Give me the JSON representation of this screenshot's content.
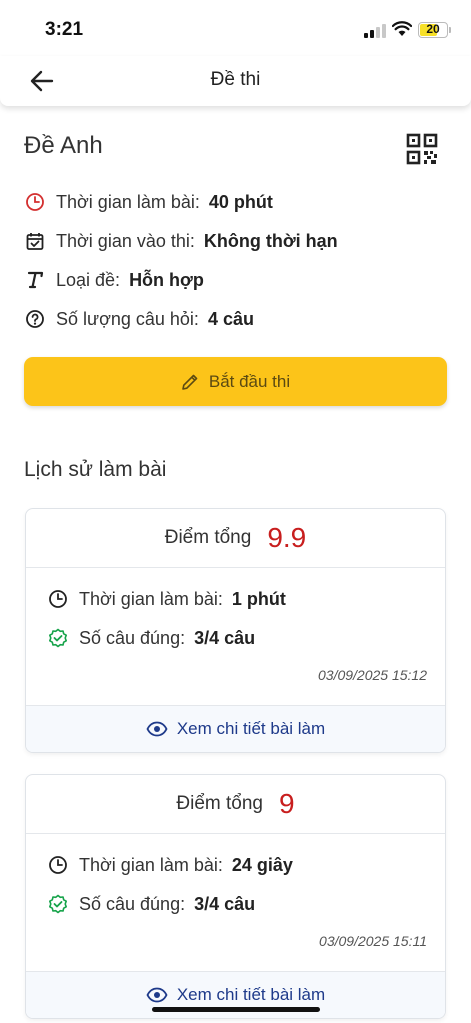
{
  "status_bar": {
    "time": "3:21",
    "battery": "20"
  },
  "header": {
    "title": "Đề thi"
  },
  "exam": {
    "title": "Đề Anh",
    "info": [
      {
        "icon": "clock-icon",
        "label": "Thời gian làm bài:",
        "value": "40 phút"
      },
      {
        "icon": "calendar-check-icon",
        "label": "Thời gian vào thi:",
        "value": "Không thời hạn"
      },
      {
        "icon": "text-type-icon",
        "label": "Loại đề:",
        "value": "Hỗn hợp"
      },
      {
        "icon": "question-circle-icon",
        "label": "Số lượng câu hỏi:",
        "value": "4 câu"
      }
    ],
    "start_label": "Bắt đầu thi"
  },
  "history": {
    "title": "Lịch sử làm bài",
    "attempts": [
      {
        "score_label": "Điểm tổng",
        "score": "9.9",
        "time_label": "Thời gian làm bài:",
        "time_value": "1 phút",
        "correct_label": "Số câu đúng:",
        "correct_value": "3/4 câu",
        "datetime": "03/09/2025 15:12",
        "detail_label": "Xem chi tiết bài làm"
      },
      {
        "score_label": "Điểm tổng",
        "score": "9",
        "time_label": "Thời gian làm bài:",
        "time_value": "24 giây",
        "correct_label": "Số câu đúng:",
        "correct_value": "3/4 câu",
        "datetime": "03/09/2025 15:11",
        "detail_label": "Xem chi tiết bài làm"
      }
    ]
  },
  "colors": {
    "accent": "#fcc419",
    "score": "#c81e1e",
    "link": "#1e3a8a",
    "success": "#16a34a",
    "clock_red": "#d32f2f"
  }
}
